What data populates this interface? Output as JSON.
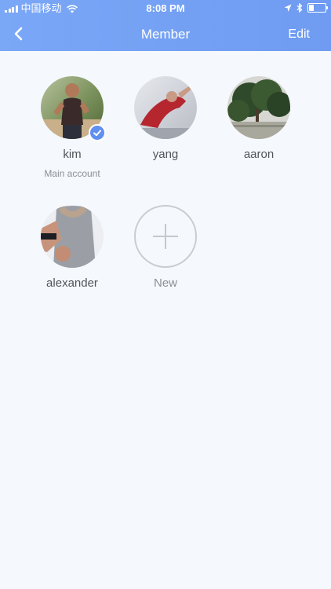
{
  "status_bar": {
    "carrier": "中国移动",
    "time": "8:08 PM",
    "battery_level": 0.3
  },
  "header": {
    "title": "Member",
    "edit_label": "Edit",
    "back_icon": "chevron-left-icon"
  },
  "members": [
    {
      "name": "kim",
      "subtitle": "Main account",
      "verified": true
    },
    {
      "name": "yang"
    },
    {
      "name": "aaron"
    },
    {
      "name": "alexander"
    }
  ],
  "add_member": {
    "label": "New",
    "icon": "plus-icon"
  },
  "colors": {
    "header": "#779ff3",
    "background": "#f5f8fd",
    "badge": "#5f8ff0"
  }
}
